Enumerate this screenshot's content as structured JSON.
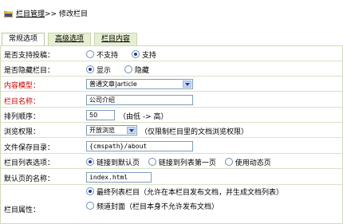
{
  "breadcrumb": {
    "link": "栏目管理",
    "separator": ">>",
    "current": "修改栏目"
  },
  "tabs": [
    {
      "label": "常规选项",
      "active": true
    },
    {
      "label": "高级选项",
      "active": false
    },
    {
      "label": "栏目内容",
      "active": false
    }
  ],
  "form": {
    "allow_submit": {
      "label": "是否支持投稿：",
      "options": [
        "不支持",
        "支持"
      ],
      "selected": "支持"
    },
    "hidden": {
      "label": "是否隐藏栏目：",
      "options": [
        "显示",
        "隐藏"
      ],
      "selected": "显示"
    },
    "content_model": {
      "label": "内容模型：",
      "value": "普通文章|article"
    },
    "category_name": {
      "label": "栏目名称：",
      "value": "公司介绍"
    },
    "sort_order": {
      "label": "排列顺序：",
      "value": "50",
      "hint": "（由低 -> 高）"
    },
    "browse_permission": {
      "label": "浏览权限：",
      "value": "开放浏览",
      "hint": "（仅限制栏目里的文档浏览权限）"
    },
    "save_dir": {
      "label": "文件保存目录：",
      "value": "{cmspath}/about"
    },
    "list_options": {
      "label": "栏目列表选项：",
      "options": [
        "链接到默认页",
        "链接到列表第一页",
        "使用动态页"
      ],
      "selected": "链接到默认页"
    },
    "default_page": {
      "label": "默认页的名称：",
      "value": "index.html"
    },
    "category_attr": {
      "label": "栏目属性：",
      "options": [
        "最终列表栏目（允许在本栏目发布文档，并生成文档列表）",
        "频道封面（栏目本身不允许发布文档）"
      ],
      "selected": "最终列表栏目（允许在本栏目发布文档，并生成文档列表）"
    }
  },
  "colors": {
    "required_label": "#cc0000",
    "tab_bg": "#e6efd2",
    "row_border": "#d8e2c6"
  }
}
